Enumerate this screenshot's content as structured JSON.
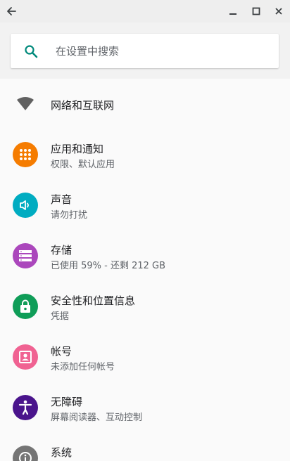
{
  "window": {
    "back_icon": "arrow-left-icon",
    "minimize_icon": "minimize-icon",
    "maximize_icon": "maximize-icon",
    "close_icon": "close-icon"
  },
  "search": {
    "placeholder": "在设置中搜索",
    "value": "",
    "icon": "search-icon",
    "icon_color": "#00897b"
  },
  "items": [
    {
      "title": "网络和互联网",
      "subtitle": "",
      "icon": "wifi-icon",
      "color": "#616161"
    },
    {
      "title": "应用和通知",
      "subtitle": "权限、默认应用",
      "icon": "apps-grid-icon",
      "color": "#f57c00"
    },
    {
      "title": "声音",
      "subtitle": "请勿打扰",
      "icon": "volume-icon",
      "color": "#00acc1"
    },
    {
      "title": "存储",
      "subtitle": "已使用 59% - 还剩 212 GB",
      "icon": "storage-icon",
      "color": "#ab47bc"
    },
    {
      "title": "安全性和位置信息",
      "subtitle": "凭据",
      "icon": "lock-icon",
      "color": "#0f9d58"
    },
    {
      "title": "帐号",
      "subtitle": "未添加任何帐号",
      "icon": "account-icon",
      "color": "#f06292"
    },
    {
      "title": "无障碍",
      "subtitle": "屏幕阅读器、互动控制",
      "icon": "accessibility-icon",
      "color": "#4a148c"
    },
    {
      "title": "系统",
      "subtitle": "",
      "icon": "info-icon",
      "color": "#757575"
    }
  ]
}
